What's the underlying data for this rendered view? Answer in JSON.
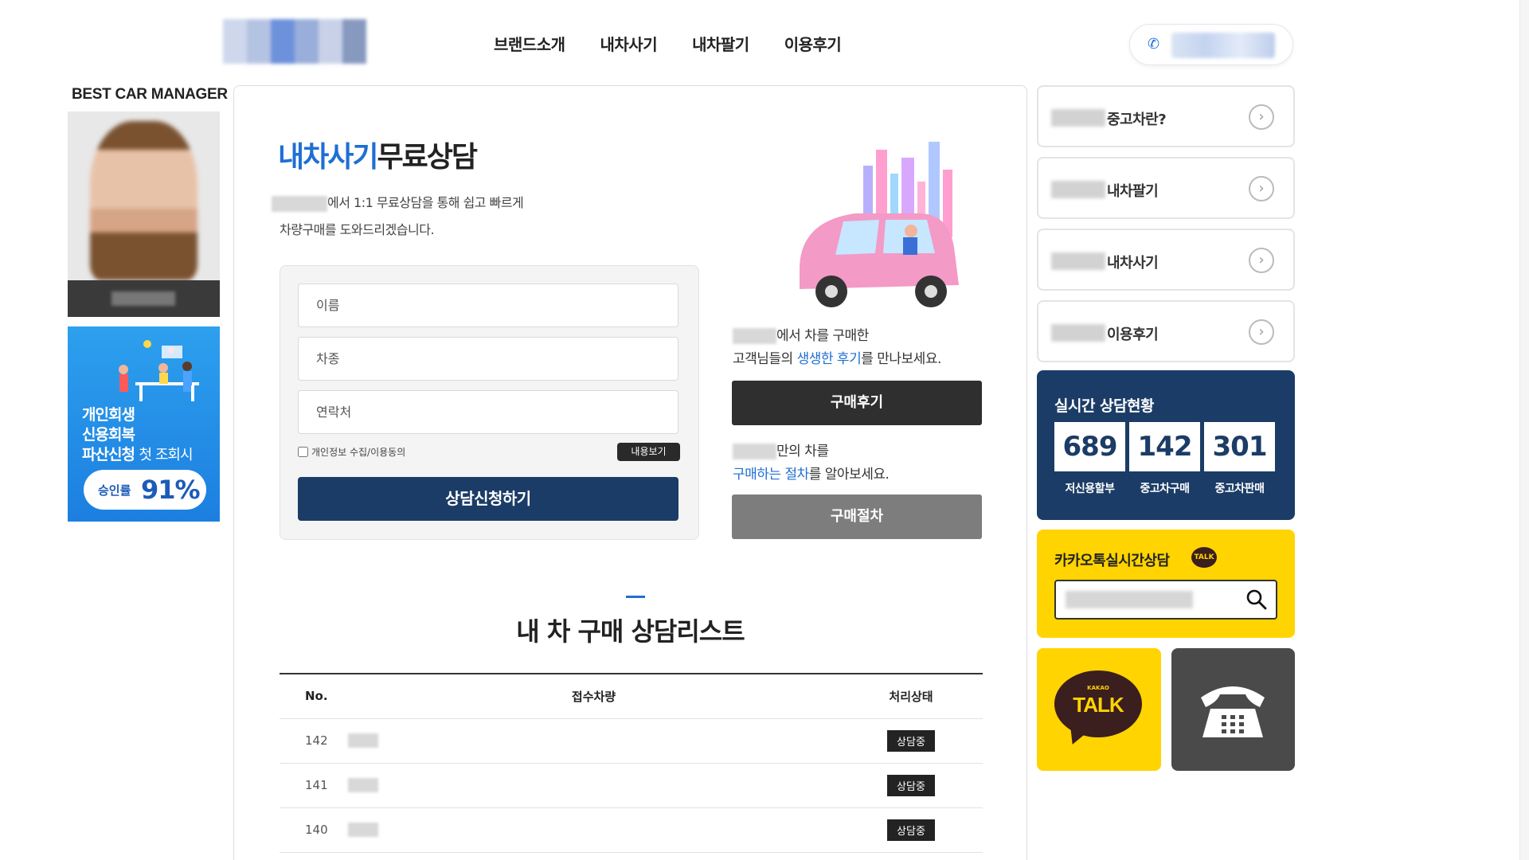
{
  "nav": {
    "items": [
      "브랜드소개",
      "내차사기",
      "내차팔기",
      "이용후기"
    ]
  },
  "left": {
    "manager_title": "BEST CAR MANAGER",
    "ad": {
      "line1": "개인회생",
      "line2": "신용회복",
      "line3a": "파산신청",
      "line3b": "첫 조회시",
      "rate_label": "승인률",
      "rate_value": "91%"
    }
  },
  "consult": {
    "title_highlight": "내차사기",
    "title_rest": "무료상담",
    "desc_line1": "에서 1:1 무료상담을 통해 쉽고 빠르게",
    "desc_line2": "차량구매를 도와드리겠습니다.",
    "form": {
      "name_placeholder": "이름",
      "car_placeholder": "차종",
      "contact_placeholder": "연락처",
      "agree_label": "개인정보 수집/이용동의",
      "view_button": "내용보기",
      "submit_button": "상담신청하기"
    },
    "review": {
      "line1": "에서 차를 구매한",
      "line2_a": "고객님들의 ",
      "line2_b": "생생한 후기",
      "line2_c": "를 만나보세요.",
      "button": "구매후기"
    },
    "process": {
      "line1": "만의 차를",
      "line2_a": "구매하는 절차",
      "line2_b": "를 알아보세요.",
      "button": "구매절차"
    }
  },
  "list": {
    "title": "내 차 구매 상담리스트",
    "headers": [
      "No.",
      "접수차량",
      "처리상태"
    ],
    "rows": [
      {
        "no": "142",
        "status": "상담중"
      },
      {
        "no": "141",
        "status": "상담중"
      },
      {
        "no": "140",
        "status": "상담중"
      }
    ]
  },
  "right": {
    "links": [
      "중고차란?",
      "내차팔기",
      "내차사기",
      "이용후기"
    ],
    "live": {
      "title": "실시간 상담현황",
      "counts": [
        "689",
        "142",
        "301"
      ],
      "labels": [
        "저신용할부",
        "중고차구매",
        "중고차판매"
      ]
    },
    "kakao": {
      "title": "카카오톡실시간상담",
      "badge": "TALK"
    },
    "talk_tile": {
      "small": "KAKAO",
      "big": "TALK"
    }
  },
  "colors": {
    "navy": "#1b3c66",
    "blue": "#1f6fd3",
    "kakao_yellow": "#ffd400"
  }
}
